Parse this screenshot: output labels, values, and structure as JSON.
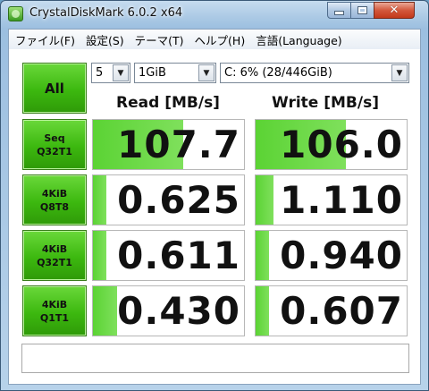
{
  "window": {
    "title": "CrystalDiskMark 6.0.2 x64"
  },
  "menu": [
    "ファイル(F)",
    "設定(S)",
    "テーマ(T)",
    "ヘルプ(H)",
    "言語(Language)"
  ],
  "controls": {
    "all_label": "All",
    "test_count": "5",
    "test_size": "1GiB",
    "drive": "C: 6% (28/446GiB)"
  },
  "headers": {
    "read": "Read [MB/s]",
    "write": "Write [MB/s]"
  },
  "rows": [
    {
      "line1": "Seq",
      "line2": "Q32T1",
      "read": "107.7",
      "write": "106.0",
      "read_fill": 0.6,
      "write_fill": 0.6
    },
    {
      "line1": "4KiB",
      "line2": "Q8T8",
      "read": "0.625",
      "write": "1.110",
      "read_fill": 0.09,
      "write_fill": 0.12
    },
    {
      "line1": "4KiB",
      "line2": "Q32T1",
      "read": "0.611",
      "write": "0.940",
      "read_fill": 0.09,
      "write_fill": 0.09
    },
    {
      "line1": "4KiB",
      "line2": "Q1T1",
      "read": "0.430",
      "write": "0.607",
      "read_fill": 0.16,
      "write_fill": 0.09
    }
  ],
  "comment": "",
  "colors": {
    "accent_green": "#3cb80f",
    "bar_green": "#5bd334"
  }
}
